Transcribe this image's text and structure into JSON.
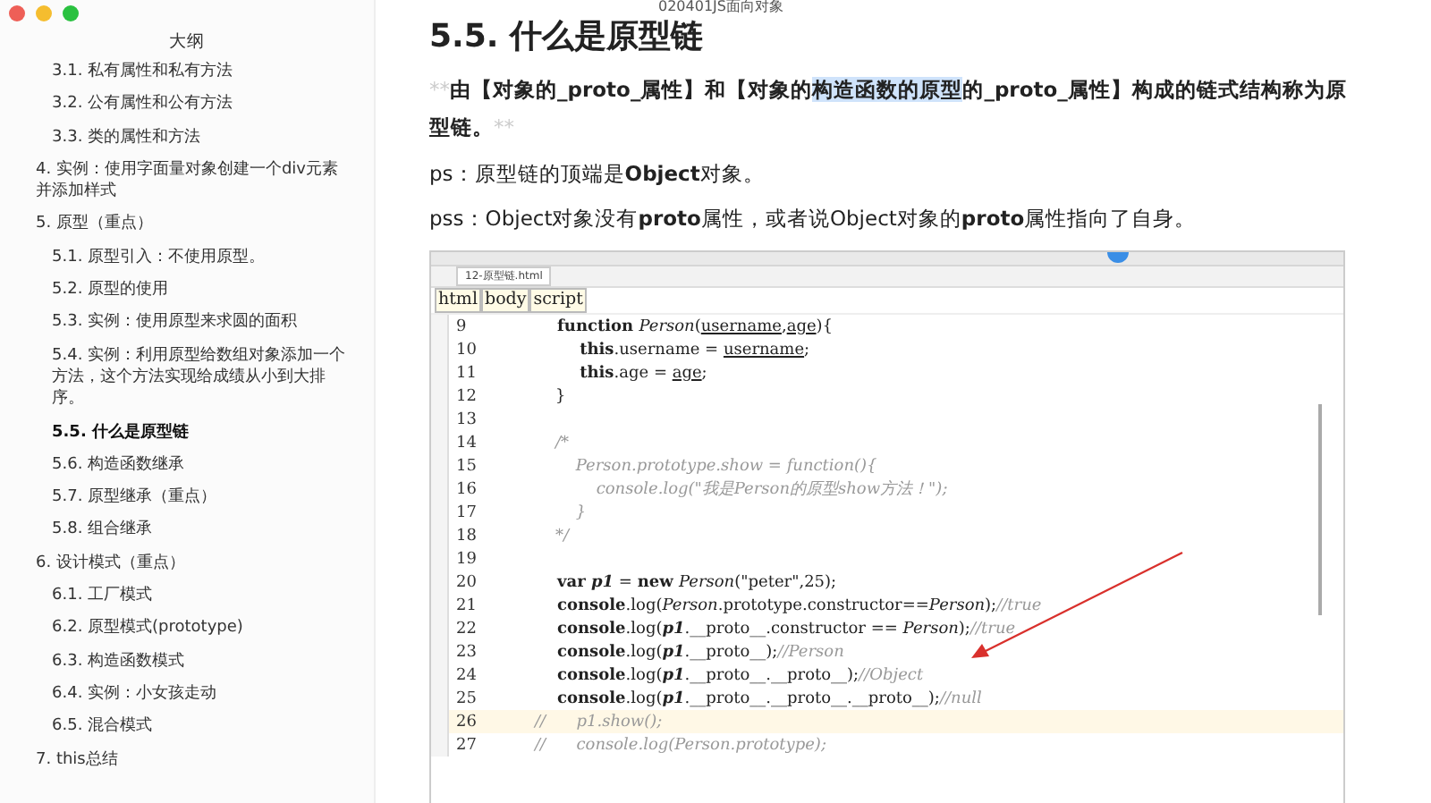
{
  "window": {
    "title": "020401JS面向对象"
  },
  "outline": {
    "title": "大纲",
    "continued_children": [
      {
        "label": "3.1. 私有属性和私有方法",
        "selected": false
      },
      {
        "label": "3.2. 公有属性和公有方法",
        "selected": false
      },
      {
        "label": "3.3. 类的属性和方法",
        "selected": false
      }
    ],
    "items": [
      {
        "label": "4. 实例：使用字面量对象创建一个div元素并添加样式",
        "selected": false
      },
      {
        "label": "5. 原型（重点）",
        "selected": false,
        "children": [
          {
            "label": "5.1. 原型引入：不使用原型。",
            "selected": false
          },
          {
            "label": "5.2. 原型的使用",
            "selected": false
          },
          {
            "label": "5.3. 实例：使用原型来求圆的面积",
            "selected": false
          },
          {
            "label": "5.4. 实例：利用原型给数组对象添加一个方法，这个方法实现给成绩从小到大排序。",
            "selected": false
          },
          {
            "label": "5.5. 什么是原型链",
            "selected": true
          },
          {
            "label": "5.6. 构造函数继承",
            "selected": false
          },
          {
            "label": "5.7. 原型继承（重点）",
            "selected": false
          },
          {
            "label": "5.8. 组合继承",
            "selected": false
          }
        ]
      },
      {
        "label": "6. 设计模式（重点）",
        "selected": false,
        "children": [
          {
            "label": "6.1. 工厂模式",
            "selected": false
          },
          {
            "label": "6.2. 原型模式(prototype)",
            "selected": false
          },
          {
            "label": "6.3. 构造函数模式",
            "selected": false
          },
          {
            "label": "6.4. 实例：小女孩走动",
            "selected": false
          },
          {
            "label": "6.5. 混合模式",
            "selected": false
          }
        ]
      },
      {
        "label": "7. this总结",
        "selected": false
      }
    ]
  },
  "document": {
    "heading": "5.5. 什么是原型链",
    "intro": [
      {
        "text": "**",
        "kind": "marker"
      },
      {
        "text": "由【对象的_proto_属性】和【对象的",
        "kind": "bold"
      },
      {
        "text": "构造函数的原型",
        "kind": "highlight"
      },
      {
        "text": "的_proto_属性】构成的链式结构称为原型链。",
        "kind": "bold"
      },
      {
        "text": "**",
        "kind": "marker"
      }
    ],
    "paragraphs": [
      "ps：原型链的顶端是**Object**对象。",
      "pss：Object对象没有**proto**属性，或者说Object对象的**proto**属性指向了自身。"
    ],
    "code_screenshot": {
      "tab": "12-原型链.html",
      "breadcrumb": [
        "html",
        "body",
        "script"
      ],
      "lines": [
        {
          "number": "9",
          "current": false,
          "segments": [
            {
              "text": "    function ",
              "kind": "kw"
            },
            {
              "text": "Person",
              "kind": "it"
            },
            {
              "text": "(",
              "kind": "plain"
            },
            {
              "text": "username",
              "kind": "ul"
            },
            {
              "text": ",",
              "kind": "plain"
            },
            {
              "text": "age",
              "kind": "ul"
            },
            {
              "text": "){",
              "kind": "plain"
            }
          ]
        },
        {
          "number": "10",
          "current": false,
          "segments": [
            {
              "text": "        this",
              "kind": "kw"
            },
            {
              "text": ".username = ",
              "kind": "plain"
            },
            {
              "text": "username",
              "kind": "ul"
            },
            {
              "text": ";",
              "kind": "plain"
            }
          ]
        },
        {
          "number": "11",
          "current": false,
          "segments": [
            {
              "text": "        this",
              "kind": "kw"
            },
            {
              "text": ".age = ",
              "kind": "plain"
            },
            {
              "text": "age",
              "kind": "ul"
            },
            {
              "text": ";",
              "kind": "plain"
            }
          ]
        },
        {
          "number": "12",
          "current": false,
          "segments": [
            {
              "text": "    }",
              "kind": "plain"
            }
          ]
        },
        {
          "number": "13",
          "current": false
        },
        {
          "number": "14",
          "current": false,
          "segments": [
            {
              "text": "    /*",
              "kind": "cm"
            }
          ]
        },
        {
          "number": "15",
          "current": false,
          "segments": [
            {
              "text": "        Person.prototype.show = function(){",
              "kind": "cm"
            }
          ]
        },
        {
          "number": "16",
          "current": false,
          "segments": [
            {
              "text": "            console.log(\"我是Person的原型show方法！\");",
              "kind": "cm"
            }
          ]
        },
        {
          "number": "17",
          "current": false,
          "segments": [
            {
              "text": "        }",
              "kind": "cm"
            }
          ]
        },
        {
          "number": "18",
          "current": false,
          "segments": [
            {
              "text": "    */",
              "kind": "cm"
            }
          ]
        },
        {
          "number": "19",
          "current": false
        },
        {
          "number": "20",
          "current": false,
          "segments": [
            {
              "text": "    var ",
              "kind": "kw"
            },
            {
              "text": "p1",
              "kind": "bi"
            },
            {
              "text": " = ",
              "kind": "plain"
            },
            {
              "text": "new ",
              "kind": "kw"
            },
            {
              "text": "Person",
              "kind": "it"
            },
            {
              "text": "(\"peter\",25);",
              "kind": "plain"
            }
          ]
        },
        {
          "number": "21",
          "current": false,
          "segments": [
            {
              "text": "    console",
              "kind": "kw"
            },
            {
              "text": ".log(",
              "kind": "plain"
            },
            {
              "text": "Person",
              "kind": "it"
            },
            {
              "text": ".prototype.constructor==",
              "kind": "plain"
            },
            {
              "text": "Person",
              "kind": "it"
            },
            {
              "text": ");",
              "kind": "plain"
            },
            {
              "text": "//true",
              "kind": "cm"
            }
          ]
        },
        {
          "number": "22",
          "current": false,
          "segments": [
            {
              "text": "    console",
              "kind": "kw"
            },
            {
              "text": ".log(",
              "kind": "plain"
            },
            {
              "text": "p1",
              "kind": "bi"
            },
            {
              "text": ".__proto__.constructor == ",
              "kind": "plain"
            },
            {
              "text": "Person",
              "kind": "it"
            },
            {
              "text": ");",
              "kind": "plain"
            },
            {
              "text": "//true",
              "kind": "cm"
            }
          ]
        },
        {
          "number": "23",
          "current": false,
          "segments": [
            {
              "text": "    console",
              "kind": "kw"
            },
            {
              "text": ".log(",
              "kind": "plain"
            },
            {
              "text": "p1",
              "kind": "bi"
            },
            {
              "text": ".__proto__);",
              "kind": "plain"
            },
            {
              "text": "//Person",
              "kind": "cm"
            }
          ]
        },
        {
          "number": "24",
          "current": false,
          "segments": [
            {
              "text": "    console",
              "kind": "kw"
            },
            {
              "text": ".log(",
              "kind": "plain"
            },
            {
              "text": "p1",
              "kind": "bi"
            },
            {
              "text": ".__proto__.__proto__);",
              "kind": "plain"
            },
            {
              "text": "//Object",
              "kind": "cm"
            }
          ]
        },
        {
          "number": "25",
          "current": false,
          "segments": [
            {
              "text": "    console",
              "kind": "kw"
            },
            {
              "text": ".log(",
              "kind": "plain"
            },
            {
              "text": "p1",
              "kind": "bi"
            },
            {
              "text": ".__proto__.__proto__.__proto__);",
              "kind": "plain"
            },
            {
              "text": "//null",
              "kind": "cm"
            }
          ]
        },
        {
          "number": "26",
          "current": true,
          "segments": [
            {
              "text": "//      p1.show();",
              "kind": "cm"
            }
          ]
        },
        {
          "number": "27",
          "current": false,
          "segments": [
            {
              "text": "//      console.log(Person.prototype);",
              "kind": "cm"
            }
          ]
        }
      ]
    }
  }
}
